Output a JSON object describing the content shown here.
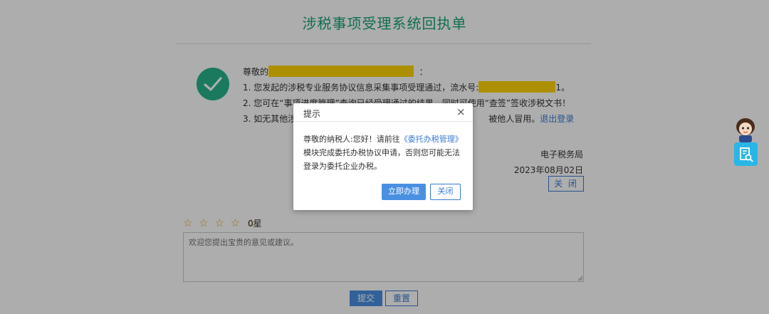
{
  "page": {
    "title": "涉税事项受理系统回执单",
    "greeting_prefix": "尊敬的",
    "greeting_suffix": "：",
    "item1_prefix": "1. 您发起的涉税专业服务协议信息采集事项受理通过，流水号:",
    "item1_suffix": "1。",
    "item2": "2. 您可在“事项进度管理”查询已经受理通过的结果，同时可使用“查签”签收涉税文书！",
    "item3_prefix": "3. 如无其他涉",
    "item3_suffix": "被他人冒用。",
    "logout_link": "退出登录",
    "office": "电子税务局",
    "date": "2023年08月02日",
    "close_button": "关 闭"
  },
  "rating": {
    "stars": "☆ ☆ ☆ ☆ ☆",
    "label": "0星",
    "feedback_placeholder": "欢迎您提出宝贵的意见或建议。"
  },
  "form": {
    "submit_button": "提交",
    "reset_button": "重置"
  },
  "dialog": {
    "title": "提示",
    "close_icon": "×",
    "body_prefix": "尊敬的纳税人:您好！请前往",
    "body_link": "《委托办税管理》",
    "body_suffix": "模块完成委托办税协议申请，否则您可能无法登录为委托企业办税。",
    "ok_button": "立即办理",
    "close_button": "关闭"
  },
  "colors": {
    "title": "#1aa37a",
    "check": "#27b38b",
    "link": "#3a7bd5",
    "primary_button": "#4a90e2",
    "redaction": "#ffd400",
    "star": "#e3a424",
    "side_button": "#29b6e6"
  },
  "icons": {
    "check": "check-circle-icon",
    "dialog_close": "close-icon",
    "side": "search-document-icon",
    "assistant": "assistant-avatar-icon"
  }
}
